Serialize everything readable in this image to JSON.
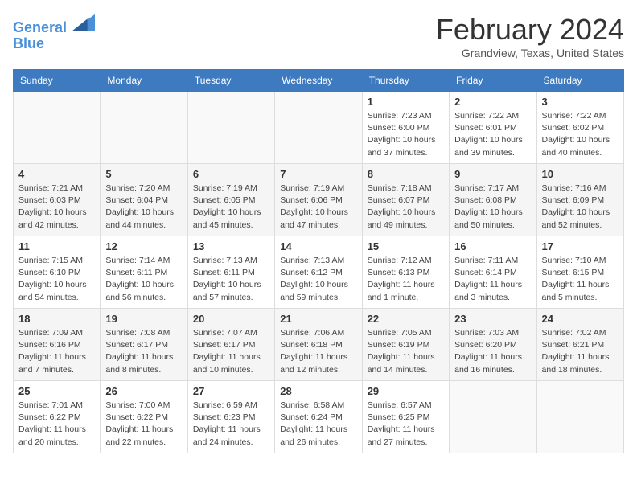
{
  "header": {
    "logo_line1": "General",
    "logo_line2": "Blue",
    "month": "February 2024",
    "location": "Grandview, Texas, United States"
  },
  "weekdays": [
    "Sunday",
    "Monday",
    "Tuesday",
    "Wednesday",
    "Thursday",
    "Friday",
    "Saturday"
  ],
  "weeks": [
    [
      {
        "day": "",
        "info": ""
      },
      {
        "day": "",
        "info": ""
      },
      {
        "day": "",
        "info": ""
      },
      {
        "day": "",
        "info": ""
      },
      {
        "day": "1",
        "info": "Sunrise: 7:23 AM\nSunset: 6:00 PM\nDaylight: 10 hours\nand 37 minutes."
      },
      {
        "day": "2",
        "info": "Sunrise: 7:22 AM\nSunset: 6:01 PM\nDaylight: 10 hours\nand 39 minutes."
      },
      {
        "day": "3",
        "info": "Sunrise: 7:22 AM\nSunset: 6:02 PM\nDaylight: 10 hours\nand 40 minutes."
      }
    ],
    [
      {
        "day": "4",
        "info": "Sunrise: 7:21 AM\nSunset: 6:03 PM\nDaylight: 10 hours\nand 42 minutes."
      },
      {
        "day": "5",
        "info": "Sunrise: 7:20 AM\nSunset: 6:04 PM\nDaylight: 10 hours\nand 44 minutes."
      },
      {
        "day": "6",
        "info": "Sunrise: 7:19 AM\nSunset: 6:05 PM\nDaylight: 10 hours\nand 45 minutes."
      },
      {
        "day": "7",
        "info": "Sunrise: 7:19 AM\nSunset: 6:06 PM\nDaylight: 10 hours\nand 47 minutes."
      },
      {
        "day": "8",
        "info": "Sunrise: 7:18 AM\nSunset: 6:07 PM\nDaylight: 10 hours\nand 49 minutes."
      },
      {
        "day": "9",
        "info": "Sunrise: 7:17 AM\nSunset: 6:08 PM\nDaylight: 10 hours\nand 50 minutes."
      },
      {
        "day": "10",
        "info": "Sunrise: 7:16 AM\nSunset: 6:09 PM\nDaylight: 10 hours\nand 52 minutes."
      }
    ],
    [
      {
        "day": "11",
        "info": "Sunrise: 7:15 AM\nSunset: 6:10 PM\nDaylight: 10 hours\nand 54 minutes."
      },
      {
        "day": "12",
        "info": "Sunrise: 7:14 AM\nSunset: 6:11 PM\nDaylight: 10 hours\nand 56 minutes."
      },
      {
        "day": "13",
        "info": "Sunrise: 7:13 AM\nSunset: 6:11 PM\nDaylight: 10 hours\nand 57 minutes."
      },
      {
        "day": "14",
        "info": "Sunrise: 7:13 AM\nSunset: 6:12 PM\nDaylight: 10 hours\nand 59 minutes."
      },
      {
        "day": "15",
        "info": "Sunrise: 7:12 AM\nSunset: 6:13 PM\nDaylight: 11 hours\nand 1 minute."
      },
      {
        "day": "16",
        "info": "Sunrise: 7:11 AM\nSunset: 6:14 PM\nDaylight: 11 hours\nand 3 minutes."
      },
      {
        "day": "17",
        "info": "Sunrise: 7:10 AM\nSunset: 6:15 PM\nDaylight: 11 hours\nand 5 minutes."
      }
    ],
    [
      {
        "day": "18",
        "info": "Sunrise: 7:09 AM\nSunset: 6:16 PM\nDaylight: 11 hours\nand 7 minutes."
      },
      {
        "day": "19",
        "info": "Sunrise: 7:08 AM\nSunset: 6:17 PM\nDaylight: 11 hours\nand 8 minutes."
      },
      {
        "day": "20",
        "info": "Sunrise: 7:07 AM\nSunset: 6:17 PM\nDaylight: 11 hours\nand 10 minutes."
      },
      {
        "day": "21",
        "info": "Sunrise: 7:06 AM\nSunset: 6:18 PM\nDaylight: 11 hours\nand 12 minutes."
      },
      {
        "day": "22",
        "info": "Sunrise: 7:05 AM\nSunset: 6:19 PM\nDaylight: 11 hours\nand 14 minutes."
      },
      {
        "day": "23",
        "info": "Sunrise: 7:03 AM\nSunset: 6:20 PM\nDaylight: 11 hours\nand 16 minutes."
      },
      {
        "day": "24",
        "info": "Sunrise: 7:02 AM\nSunset: 6:21 PM\nDaylight: 11 hours\nand 18 minutes."
      }
    ],
    [
      {
        "day": "25",
        "info": "Sunrise: 7:01 AM\nSunset: 6:22 PM\nDaylight: 11 hours\nand 20 minutes."
      },
      {
        "day": "26",
        "info": "Sunrise: 7:00 AM\nSunset: 6:22 PM\nDaylight: 11 hours\nand 22 minutes."
      },
      {
        "day": "27",
        "info": "Sunrise: 6:59 AM\nSunset: 6:23 PM\nDaylight: 11 hours\nand 24 minutes."
      },
      {
        "day": "28",
        "info": "Sunrise: 6:58 AM\nSunset: 6:24 PM\nDaylight: 11 hours\nand 26 minutes."
      },
      {
        "day": "29",
        "info": "Sunrise: 6:57 AM\nSunset: 6:25 PM\nDaylight: 11 hours\nand 27 minutes."
      },
      {
        "day": "",
        "info": ""
      },
      {
        "day": "",
        "info": ""
      }
    ]
  ]
}
